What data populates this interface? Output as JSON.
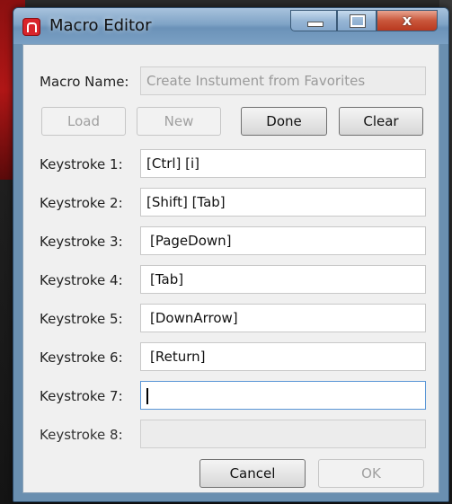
{
  "window": {
    "title": "Macro Editor"
  },
  "macro_name": {
    "label": "Macro Name:",
    "value": "Create Instument from Favorites"
  },
  "buttons": {
    "load": "Load",
    "new": "New",
    "done": "Done",
    "clear": "Clear",
    "cancel": "Cancel",
    "ok": "OK"
  },
  "keystrokes": [
    {
      "label": "Keystroke 1:",
      "value": "[Ctrl] [i]"
    },
    {
      "label": "Keystroke 2:",
      "value": "[Shift] [Tab]"
    },
    {
      "label": "Keystroke 3:",
      "value": "[PageDown]"
    },
    {
      "label": "Keystroke 4:",
      "value": "[Tab]"
    },
    {
      "label": "Keystroke 5:",
      "value": "[DownArrow]"
    },
    {
      "label": "Keystroke 6:",
      "value": "[Return]"
    },
    {
      "label": "Keystroke 7:",
      "value": ""
    },
    {
      "label": "Keystroke 8:",
      "value": ""
    }
  ],
  "colors": {
    "title_bar": "#7fa3c6",
    "close_button": "#c9563b",
    "app_icon": "#d9242b",
    "focus_border": "#5a96d6"
  },
  "icons": {
    "app": "app-logo-icon",
    "minimize": "minimize-icon",
    "maximize": "maximize-icon",
    "close": "close-icon"
  }
}
